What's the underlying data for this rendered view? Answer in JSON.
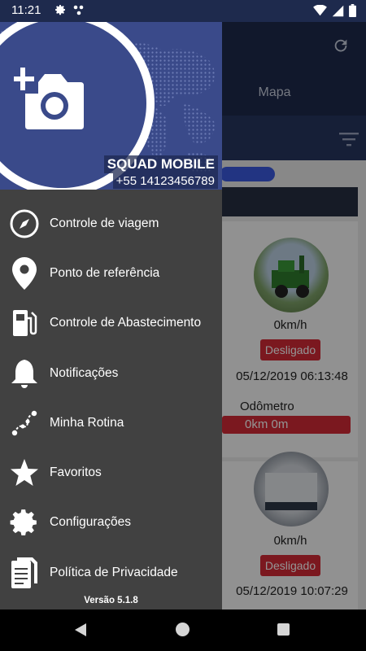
{
  "status_bar": {
    "time": "11:21",
    "icons": [
      "gear-icon",
      "dots-icon",
      "wifi-icon",
      "signal-icon",
      "battery-icon"
    ]
  },
  "background": {
    "tab_label": "Mapa",
    "vehicles": [
      {
        "speed": "0km/h",
        "status": "Desligado",
        "timestamp": "05/12/2019 06:13:48",
        "odometer_label": "Odômetro",
        "odometer_value": "0km 0m"
      },
      {
        "speed": "0km/h",
        "status": "Desligado",
        "timestamp": "05/12/2019 10:07:29"
      }
    ],
    "colors": {
      "topbar": "#1e2a4d",
      "badge": "#d42a36"
    }
  },
  "drawer": {
    "user_name": "SQUAD MOBILE",
    "user_phone": "+55 14123456789",
    "menu": [
      {
        "label": "Controle de viagem",
        "icon": "compass-icon"
      },
      {
        "label": "Ponto de referência",
        "icon": "location-pin-icon"
      },
      {
        "label": "Controle de Abastecimento",
        "icon": "fuel-pump-icon"
      },
      {
        "label": "Notificações",
        "icon": "bell-icon"
      },
      {
        "label": "Minha Rotina",
        "icon": "route-icon"
      },
      {
        "label": "Favoritos",
        "icon": "star-icon"
      },
      {
        "label": "Configurações",
        "icon": "gear-icon"
      },
      {
        "label": "Política de Privacidade",
        "icon": "document-icon"
      }
    ],
    "version": "Versão 5.1.8",
    "colors": {
      "header": "#3a4a8a",
      "panel": "#414141"
    }
  }
}
